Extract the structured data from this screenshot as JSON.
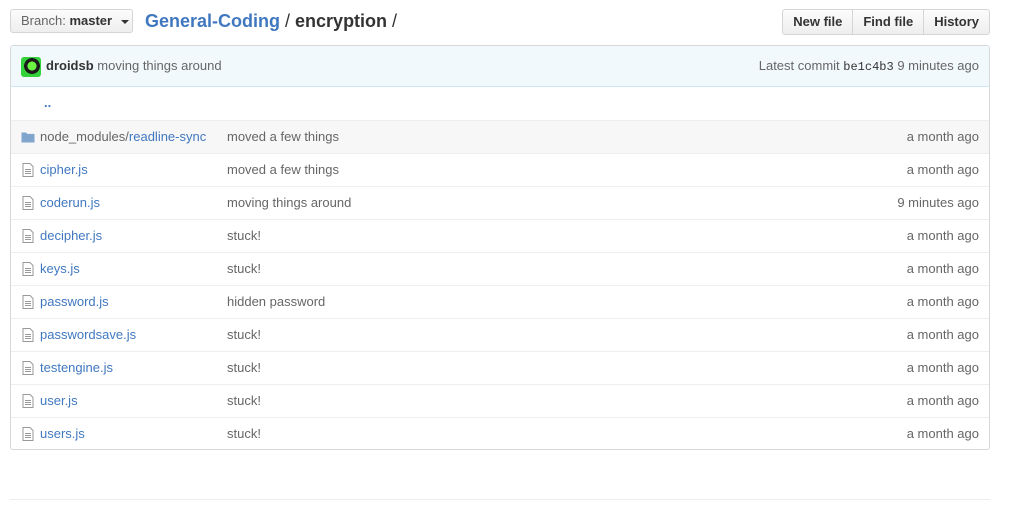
{
  "branch": {
    "prefix": "Branch:",
    "name": "master"
  },
  "breadcrumb": {
    "repo": "General-Coding",
    "sep1": "/",
    "dir": "encryption",
    "sep2": "/"
  },
  "actions": {
    "new_file": "New file",
    "find_file": "Find file",
    "history": "History"
  },
  "commit": {
    "author": "droidsb",
    "message": "moving things around",
    "latest_label": "Latest commit",
    "sha": "be1c4b3",
    "age": "9 minutes ago"
  },
  "parent_dir": "..",
  "files": [
    {
      "type": "directory",
      "name_prefix": "node_modules/",
      "name": "readline-sync",
      "message": "moved a few things",
      "age": "a month ago"
    },
    {
      "type": "file",
      "name": "cipher.js",
      "message": "moved a few things",
      "age": "a month ago"
    },
    {
      "type": "file",
      "name": "coderun.js",
      "message": "moving things around",
      "age": "9 minutes ago"
    },
    {
      "type": "file",
      "name": "decipher.js",
      "message": "stuck!",
      "age": "a month ago"
    },
    {
      "type": "file",
      "name": "keys.js",
      "message": "stuck!",
      "age": "a month ago"
    },
    {
      "type": "file",
      "name": "password.js",
      "message": "hidden password",
      "age": "a month ago"
    },
    {
      "type": "file",
      "name": "passwordsave.js",
      "message": "stuck!",
      "age": "a month ago"
    },
    {
      "type": "file",
      "name": "testengine.js",
      "message": "stuck!",
      "age": "a month ago"
    },
    {
      "type": "file",
      "name": "user.js",
      "message": "stuck!",
      "age": "a month ago"
    },
    {
      "type": "file",
      "name": "users.js",
      "message": "stuck!",
      "age": "a month ago"
    }
  ],
  "colors": {
    "link": "#4078c0",
    "muted": "#666666",
    "commit_bg": "#f2f9fc",
    "folder_icon": "#80a6cd"
  }
}
